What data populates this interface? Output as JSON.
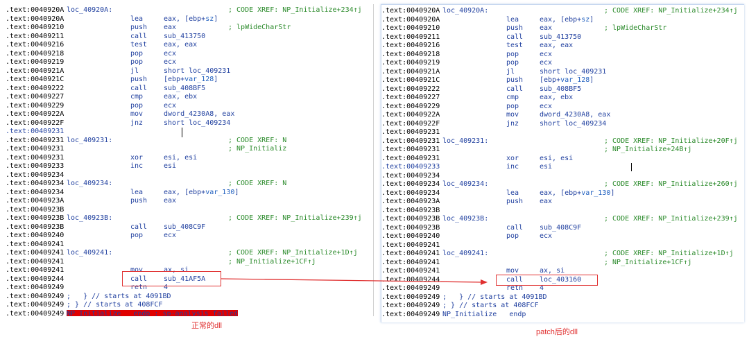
{
  "left": {
    "rows": [
      {
        "addr": ".text:0040920A",
        "label": "loc_40920A:",
        "comment": "; CODE XREF: NP_Initialize+234↑j"
      },
      {
        "addr": ".text:0040920A",
        "mn": "lea",
        "op": "eax, [ebp+",
        "opv": "sz",
        "op2": "]"
      },
      {
        "addr": ".text:00409210",
        "mn": "push",
        "op": "eax",
        "comment": "; lpWideCharStr"
      },
      {
        "addr": ".text:00409211",
        "mn": "call",
        "op": "sub_413750"
      },
      {
        "addr": ".text:00409216",
        "mn": "test",
        "op": "eax, eax"
      },
      {
        "addr": ".text:00409218",
        "mn": "pop",
        "op": "ecx"
      },
      {
        "addr": ".text:00409219",
        "mn": "pop",
        "op": "ecx"
      },
      {
        "addr": ".text:0040921A",
        "mn": "jl",
        "op": "short loc_409231"
      },
      {
        "addr": ".text:0040921C",
        "mn": "push",
        "op": "[ebp+",
        "opv": "var_128",
        "op2": "]"
      },
      {
        "addr": ".text:00409222",
        "mn": "call",
        "op": "sub_408BF5"
      },
      {
        "addr": ".text:00409227",
        "mn": "cmp",
        "op": "eax, ebx"
      },
      {
        "addr": ".text:00409229",
        "mn": "pop",
        "op": "ecx"
      },
      {
        "addr": ".text:0040922A",
        "mn": "mov",
        "op": "dword_4230A8, eax"
      },
      {
        "addr": ".text:0040922F",
        "mn": "jnz",
        "op": "short loc_409234"
      },
      {
        "addr": ".text:00409231",
        "sel": true
      },
      {
        "addr": ".text:00409231",
        "label": "loc_409231:",
        "comment": "; CODE XREF: N"
      },
      {
        "addr": ".text:00409231",
        "comment": "; NP_Initializ"
      },
      {
        "addr": ".text:00409231",
        "mn": "xor",
        "op": "esi, esi"
      },
      {
        "addr": ".text:00409233",
        "mn": "inc",
        "op": "esi"
      },
      {
        "addr": ".text:00409234"
      },
      {
        "addr": ".text:00409234",
        "label": "loc_409234:",
        "comment": "; CODE XREF: N"
      },
      {
        "addr": ".text:00409234",
        "mn": "lea",
        "op": "eax, [ebp+",
        "opv": "var_130",
        "op2": "]"
      },
      {
        "addr": ".text:0040923A",
        "mn": "push",
        "op": "eax"
      },
      {
        "addr": ".text:0040923B"
      },
      {
        "addr": ".text:0040923B",
        "label": "loc_40923B:",
        "comment": "; CODE XREF: NP_Initialize+239↑j"
      },
      {
        "addr": ".text:0040923B",
        "mn": "call",
        "op": "sub_408C9F"
      },
      {
        "addr": ".text:00409240",
        "mn": "pop",
        "op": "ecx"
      },
      {
        "addr": ".text:00409241"
      },
      {
        "addr": ".text:00409241",
        "label": "loc_409241:",
        "comment": "; CODE XREF: NP_Initialize+1D↑j"
      },
      {
        "addr": ".text:00409241",
        "comment": "; NP_Initialize+1CF↑j"
      },
      {
        "addr": ".text:00409241",
        "mn": "mov",
        "op": "ax, si"
      },
      {
        "addr": ".text:00409244",
        "mn": "call",
        "op": "sub_41AF5A"
      },
      {
        "addr": ".text:00409249",
        "mn": "retn",
        "op": "4"
      },
      {
        "addr": ".text:00409249",
        "inline": ";   } // starts at 4091BD"
      },
      {
        "addr": ".text:00409249",
        "inline": "; } // starts at 408FCF"
      },
      {
        "addr": ".text:00409249",
        "endp": "NP_Initialize   endp ; sp-analysis failed"
      }
    ]
  },
  "right": {
    "rows": [
      {
        "addr": ".text:0040920A",
        "label": "loc_40920A:",
        "comment": "; CODE XREF: NP_Initialize+234↑j"
      },
      {
        "addr": ".text:0040920A",
        "mn": "lea",
        "op": "eax, [ebp+",
        "opv": "sz",
        "op2": "]"
      },
      {
        "addr": ".text:00409210",
        "mn": "push",
        "op": "eax",
        "comment": "; lpWideCharStr"
      },
      {
        "addr": ".text:00409211",
        "mn": "call",
        "op": "sub_413750"
      },
      {
        "addr": ".text:00409216",
        "mn": "test",
        "op": "eax, eax"
      },
      {
        "addr": ".text:00409218",
        "mn": "pop",
        "op": "ecx"
      },
      {
        "addr": ".text:00409219",
        "mn": "pop",
        "op": "ecx"
      },
      {
        "addr": ".text:0040921A",
        "mn": "jl",
        "op": "short loc_409231"
      },
      {
        "addr": ".text:0040921C",
        "mn": "push",
        "op": "[ebp+",
        "opv": "var_128",
        "op2": "]"
      },
      {
        "addr": ".text:00409222",
        "mn": "call",
        "op": "sub_408BF5"
      },
      {
        "addr": ".text:00409227",
        "mn": "cmp",
        "op": "eax, ebx"
      },
      {
        "addr": ".text:00409229",
        "mn": "pop",
        "op": "ecx"
      },
      {
        "addr": ".text:0040922A",
        "mn": "mov",
        "op": "dword_4230A8, eax"
      },
      {
        "addr": ".text:0040922F",
        "mn": "jnz",
        "op": "short loc_409234"
      },
      {
        "addr": ".text:00409231"
      },
      {
        "addr": ".text:00409231",
        "label": "loc_409231:",
        "comment": "; CODE XREF: NP_Initialize+20F↑j"
      },
      {
        "addr": ".text:00409231",
        "comment": "; NP_Initialize+24B↑j"
      },
      {
        "addr": ".text:00409231",
        "mn": "xor",
        "op": "esi, esi"
      },
      {
        "addr": ".text:00409233",
        "mn": "inc",
        "op": "esi",
        "sel": true
      },
      {
        "addr": ".text:00409234"
      },
      {
        "addr": ".text:00409234",
        "label": "loc_409234:",
        "comment": "; CODE XREF: NP_Initialize+260↑j"
      },
      {
        "addr": ".text:00409234",
        "mn": "lea",
        "op": "eax, [ebp+",
        "opv": "var_130",
        "op2": "]"
      },
      {
        "addr": ".text:0040923A",
        "mn": "push",
        "op": "eax"
      },
      {
        "addr": ".text:0040923B"
      },
      {
        "addr": ".text:0040923B",
        "label": "loc_40923B:",
        "comment": "; CODE XREF: NP_Initialize+239↑j"
      },
      {
        "addr": ".text:0040923B",
        "mn": "call",
        "op": "sub_408C9F"
      },
      {
        "addr": ".text:00409240",
        "mn": "pop",
        "op": "ecx"
      },
      {
        "addr": ".text:00409241"
      },
      {
        "addr": ".text:00409241",
        "label": "loc_409241:",
        "comment": "; CODE XREF: NP_Initialize+1D↑j"
      },
      {
        "addr": ".text:00409241",
        "comment": "; NP_Initialize+1CF↑j"
      },
      {
        "addr": ".text:00409241",
        "mn": "mov",
        "op": "ax, si"
      },
      {
        "addr": ".text:00409244",
        "mn": "call",
        "op": "loc_403160"
      },
      {
        "addr": ".text:00409249",
        "mn": "retn",
        "op": "4"
      },
      {
        "addr": ".text:00409249",
        "inline": ";   } // starts at 4091BD"
      },
      {
        "addr": ".text:00409249",
        "inline": "; } // starts at 408FCF"
      },
      {
        "addr": ".text:00409249",
        "endp": "NP_Initialize   endp"
      }
    ]
  },
  "captions": {
    "left": "正常的dll",
    "right": "patch后的dll"
  },
  "colors": {
    "address": "#000000",
    "code": "#1f3f9f",
    "comment": "#2a8a2a",
    "highlight": "#e00000",
    "annotation": "#e03030"
  }
}
